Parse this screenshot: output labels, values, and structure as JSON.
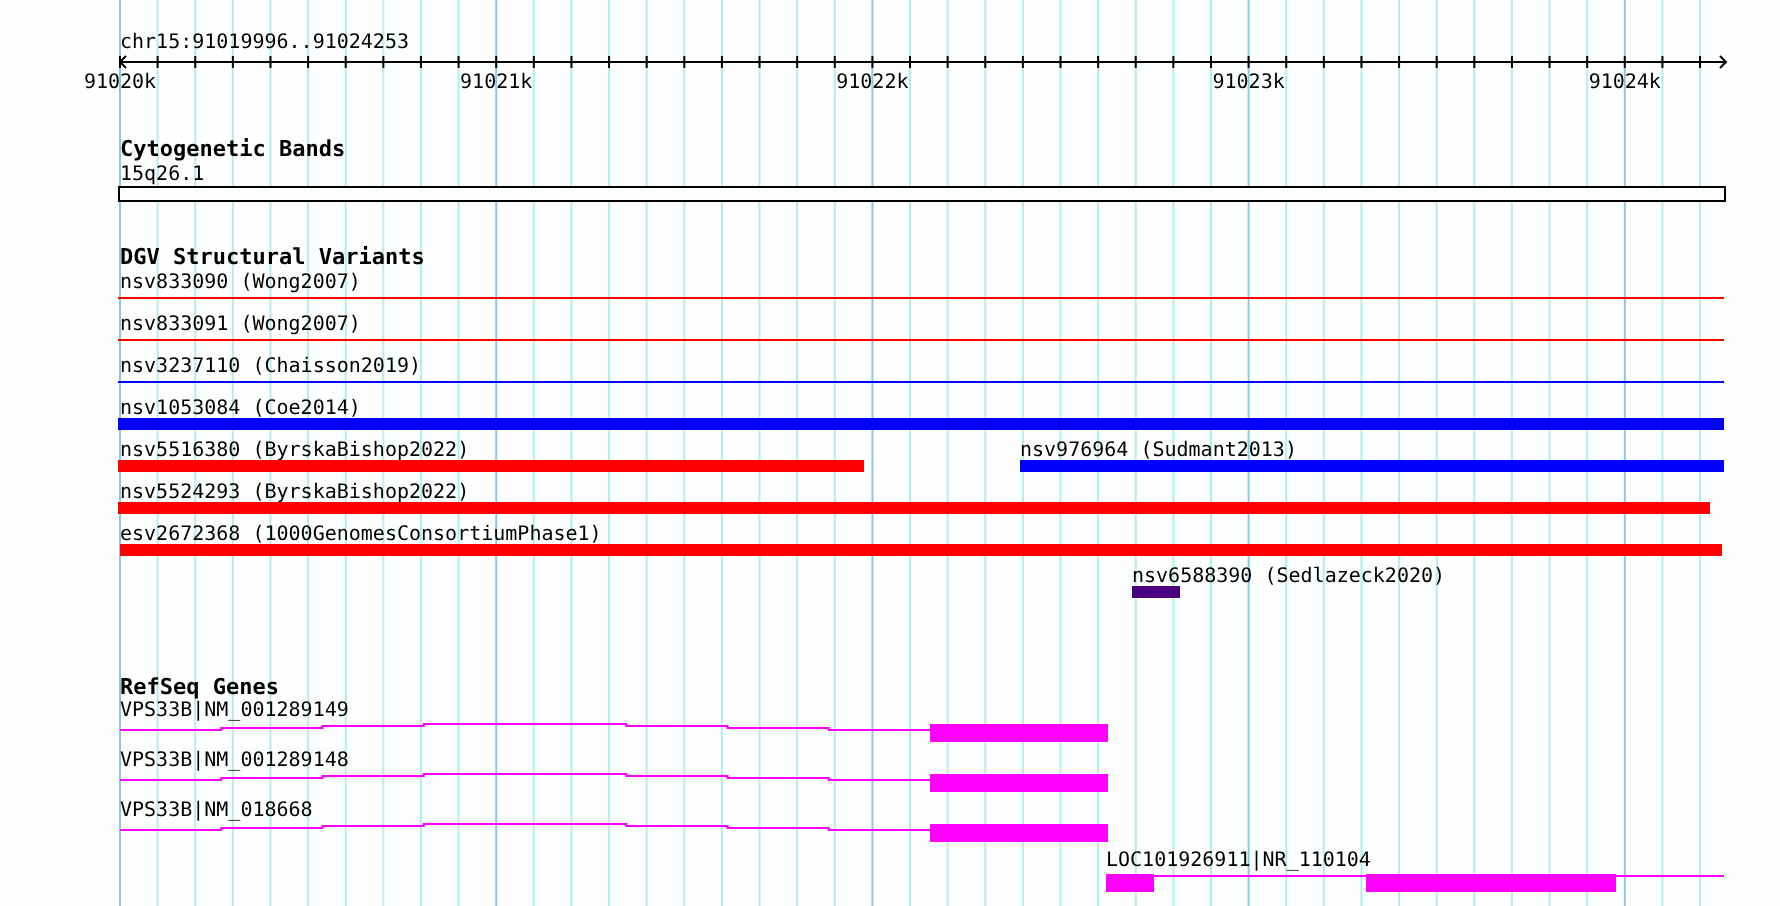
{
  "locus": "chr15:91019996..91024253",
  "ruler": {
    "ticks": [
      "91020k",
      "91021k",
      "91022k",
      "91023k",
      "91024k"
    ]
  },
  "tracks": [
    {
      "kind": "band",
      "title": "Cytogenetic Bands",
      "features": [
        {
          "label": "15q26.1"
        }
      ]
    },
    {
      "kind": "variants",
      "title": "DGV Structural Variants",
      "features": [
        {
          "label": "nsv833090 (Wong2007)",
          "color": "#ff0000",
          "kind": "line"
        },
        {
          "label": "nsv833091 (Wong2007)",
          "color": "#ff0000",
          "kind": "line"
        },
        {
          "label": "nsv3237110 (Chaisson2019)",
          "color": "#0000ff",
          "kind": "line"
        },
        {
          "label": "nsv1053084 (Coe2014)",
          "color": "#0000ff",
          "kind": "bar"
        },
        {
          "label": "nsv5516380 (ByrskaBishop2022)",
          "color": "#ff0000",
          "kind": "bar"
        },
        {
          "label": "nsv976964 (Sudmant2013)",
          "color": "#0000ff",
          "kind": "bar"
        },
        {
          "label": "nsv5524293 (ByrskaBishop2022)",
          "color": "#ff0000",
          "kind": "bar"
        },
        {
          "label": "esv2672368 (1000GenomesConsortiumPhase1)",
          "color": "#ff0000",
          "kind": "bar"
        },
        {
          "label": "nsv6588390 (Sedlazeck2020)",
          "color": "#4b0082",
          "kind": "bar"
        }
      ]
    },
    {
      "kind": "genes",
      "title": "RefSeq Genes",
      "features": [
        {
          "label": "VPS33B|NM_001289149"
        },
        {
          "label": "VPS33B|NM_001289148"
        },
        {
          "label": "VPS33B|NM_018668"
        },
        {
          "label": "LOC101926911|NR_110104"
        }
      ]
    }
  ]
}
